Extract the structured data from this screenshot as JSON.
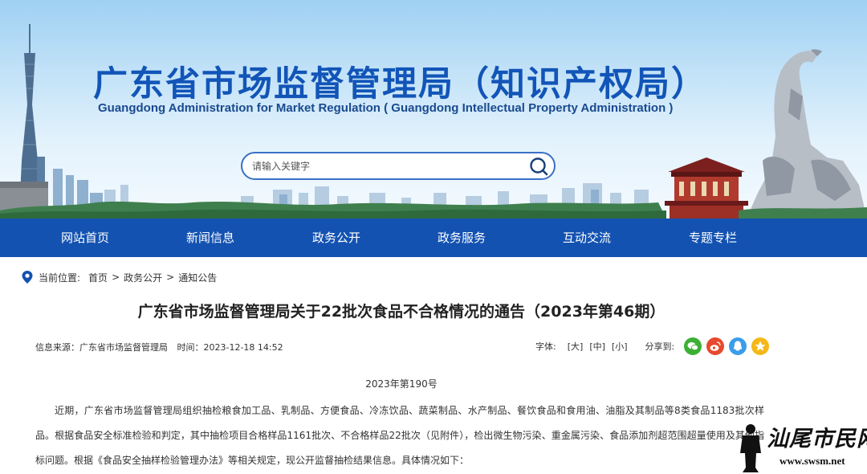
{
  "header": {
    "title_cn": "广东省市场监督管理局（知识产权局）",
    "title_en": "Guangdong Administration for Market Regulation ( Guangdong Intellectual Property Administration )",
    "search_placeholder": "请输入关键字"
  },
  "nav": {
    "items": [
      {
        "label": "网站首页"
      },
      {
        "label": "新闻信息"
      },
      {
        "label": "政务公开"
      },
      {
        "label": "政务服务"
      },
      {
        "label": "互动交流"
      },
      {
        "label": "专题专栏"
      }
    ]
  },
  "breadcrumb": {
    "prefix": "当前位置:",
    "items": [
      "首页",
      "政务公开",
      "通知公告"
    ],
    "separator": ">"
  },
  "article": {
    "title": "广东省市场监督管理局关于22批次食品不合格情况的通告（2023年第46期）",
    "source": "信息来源：广东省市场监督管理局",
    "time": "时间：2023-12-18 14:52",
    "font_label": "字体:",
    "font_large": "[大]",
    "font_medium": "[中]",
    "font_small": "[小]",
    "share_label": "分享到:",
    "doc_number": "2023年第190号",
    "paragraph": "近期，广东省市场监督管理局组织抽检粮食加工品、乳制品、方便食品、冷冻饮品、蔬菜制品、水产制品、餐饮食品和食用油、油脂及其制品等8类食品1183批次样品。根据食品安全标准检验和判定，其中抽检项目合格样品1161批次、不合格样品22批次（见附件），检出微生物污染、重金属污染、食品添加剂超范围超量使用及其他指标问题。根据《食品安全抽样检验管理办法》等相关规定，现公开监督抽检结果信息。具体情况如下："
  },
  "share": {
    "icons": [
      "wechat-icon",
      "weibo-icon",
      "qq-icon",
      "qzone-icon"
    ],
    "colors": {
      "wechat": "#3cb034",
      "weibo": "#e6492d",
      "qq": "#3b9de9",
      "qzone": "#f5b818"
    }
  },
  "watermark": {
    "text_cn": "汕尾市民网",
    "text_en": "www.swsm.net"
  },
  "colors": {
    "brand_blue": "#1352b1",
    "title_blue": "#1255b8"
  }
}
